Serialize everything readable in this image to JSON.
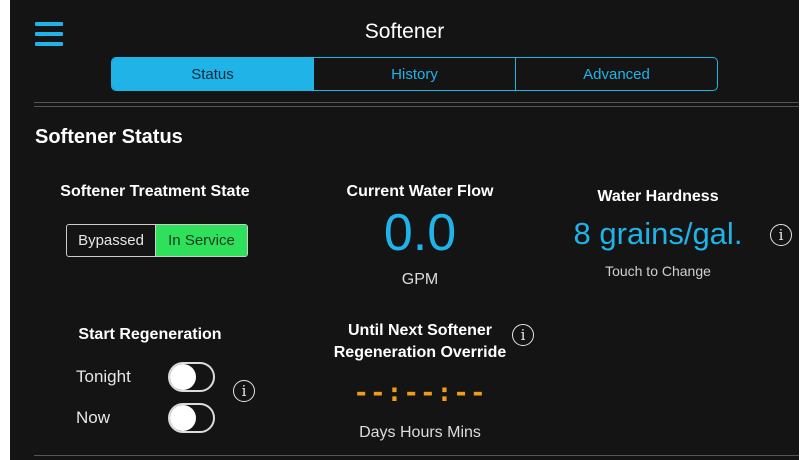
{
  "header": {
    "menu_icon": "hamburger-menu-icon",
    "title": "Softener"
  },
  "tabs": [
    {
      "label": "Status",
      "active": true
    },
    {
      "label": "History",
      "active": false
    },
    {
      "label": "Advanced",
      "active": false
    }
  ],
  "section": {
    "title": "Softener Status"
  },
  "treatment": {
    "label": "Softener Treatment State",
    "options": [
      "Bypassed",
      "In Service"
    ],
    "selected": "In Service"
  },
  "flow": {
    "label": "Current Water Flow",
    "value": "0.0",
    "unit": "GPM"
  },
  "hardness": {
    "label": "Water Hardness",
    "value": "8 grains/gal.",
    "hint": "Touch to Change",
    "info_icon": "info-icon"
  },
  "regeneration": {
    "label": "Start Regeneration",
    "toggles": [
      {
        "label": "Tonight",
        "on": false
      },
      {
        "label": "Now",
        "on": false
      }
    ],
    "info_icon": "info-icon"
  },
  "override": {
    "label_line1": "Until Next Softener",
    "label_line2": "Regeneration Override",
    "timer": "--:--:--",
    "units": "Days Hours Mins",
    "info_icon": "info-icon"
  },
  "colors": {
    "accent": "#1fb3e8",
    "in_service": "#2fe05a",
    "timer": "#f29a1a",
    "background": "#141414"
  }
}
